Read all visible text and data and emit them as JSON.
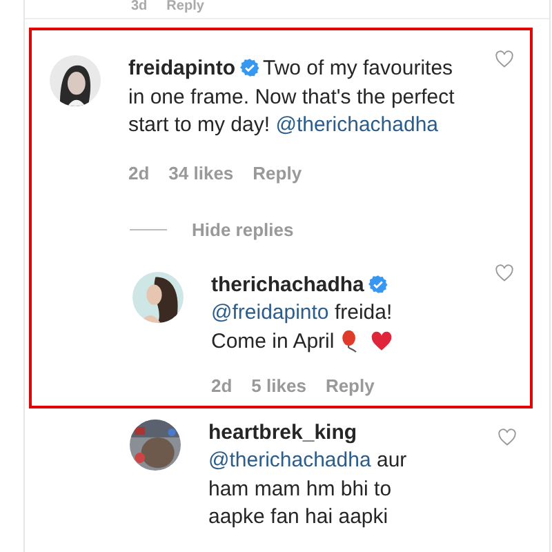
{
  "top_fragment": {
    "time": "3d",
    "reply": "Reply"
  },
  "items": [
    {
      "kind": "comment",
      "highlighted": true,
      "username": "freidapinto",
      "verified": true,
      "segments": [
        {
          "kind": "text",
          "text": "Two of my favourites in one frame. Now that's the perfect start to my day!"
        },
        {
          "kind": "mention",
          "text": "@therichachadha"
        }
      ],
      "time": "2d",
      "likes": "34 likes",
      "reply": "Reply"
    },
    {
      "kind": "hide-replies",
      "highlighted": true,
      "label": "Hide replies"
    },
    {
      "kind": "reply",
      "highlighted": true,
      "username": "therichachadha",
      "verified": true,
      "segments": [
        {
          "kind": "mention",
          "text": "@freidapinto"
        },
        {
          "kind": "text",
          "text": "freida! Come in April"
        },
        {
          "kind": "balloon"
        },
        {
          "kind": "heart"
        }
      ],
      "time": "2d",
      "likes": "5 likes",
      "reply": "Reply"
    },
    {
      "kind": "reply",
      "highlighted": false,
      "username": "heartbrek_king",
      "verified": false,
      "segments": [
        {
          "kind": "mention",
          "text": "@therichachadha"
        },
        {
          "kind": "text",
          "text": "aur ham mam hm bhi to aapke fan hai aapki"
        }
      ]
    }
  ]
}
